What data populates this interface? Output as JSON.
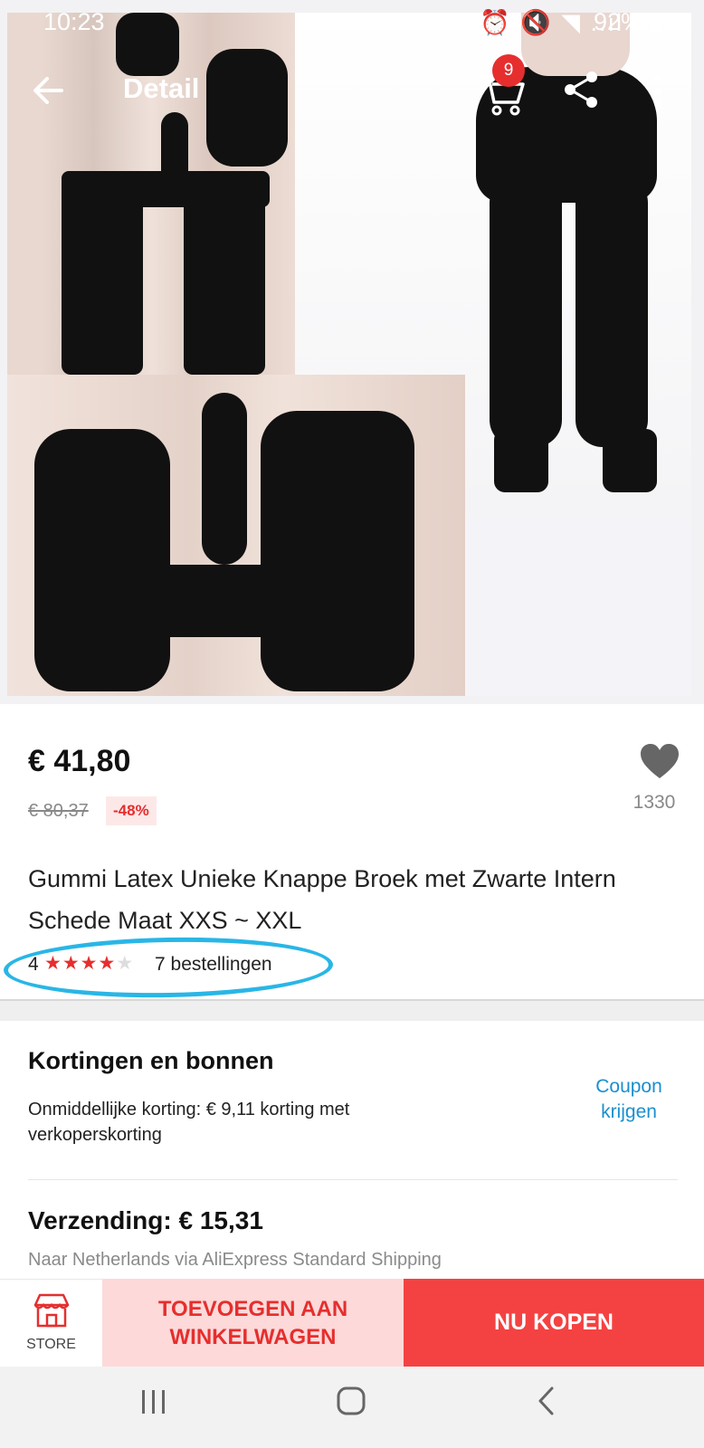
{
  "status_bar": {
    "time": "10:23",
    "icons": "⏰ 🔇 ◥ ..ıl",
    "battery": "92% ▮"
  },
  "toolbar": {
    "title": "Detail",
    "cart_count": "9",
    "icons": [
      "back-arrow-icon",
      "cart-icon",
      "share-icon",
      "more-vertical-icon"
    ]
  },
  "product": {
    "price": "€ 41,80",
    "old_price": "€ 80,37",
    "discount": "-48%",
    "wishlist_count": "1330",
    "title": "Gummi Latex Unieke Knappe Broek met Zwarte Intern Schede Maat XXS ~ XXL",
    "rating": "4",
    "stars_filled": 4,
    "stars_total": 5,
    "orders": "7 bestellingen"
  },
  "coupons": {
    "heading": "Kortingen en bonnen",
    "text": "Onmiddellijke korting: € 9,11 korting met verkoperskorting",
    "link": "Coupon krijgen"
  },
  "shipping": {
    "heading": "Verzending: € 15,31",
    "sub": "Naar Netherlands via AliExpress Standard Shipping"
  },
  "actions": {
    "store_label": "STORE",
    "add_to_cart": "TOEVOEGEN AAN WINKELWAGEN",
    "buy_now": "NU KOPEN"
  },
  "colors": {
    "accent_red": "#e62e2e",
    "buy_red": "#f44242",
    "cart_pink": "#fdd9d9",
    "link_blue": "#1a8fcf",
    "annotation_blue": "#29b6e6"
  }
}
